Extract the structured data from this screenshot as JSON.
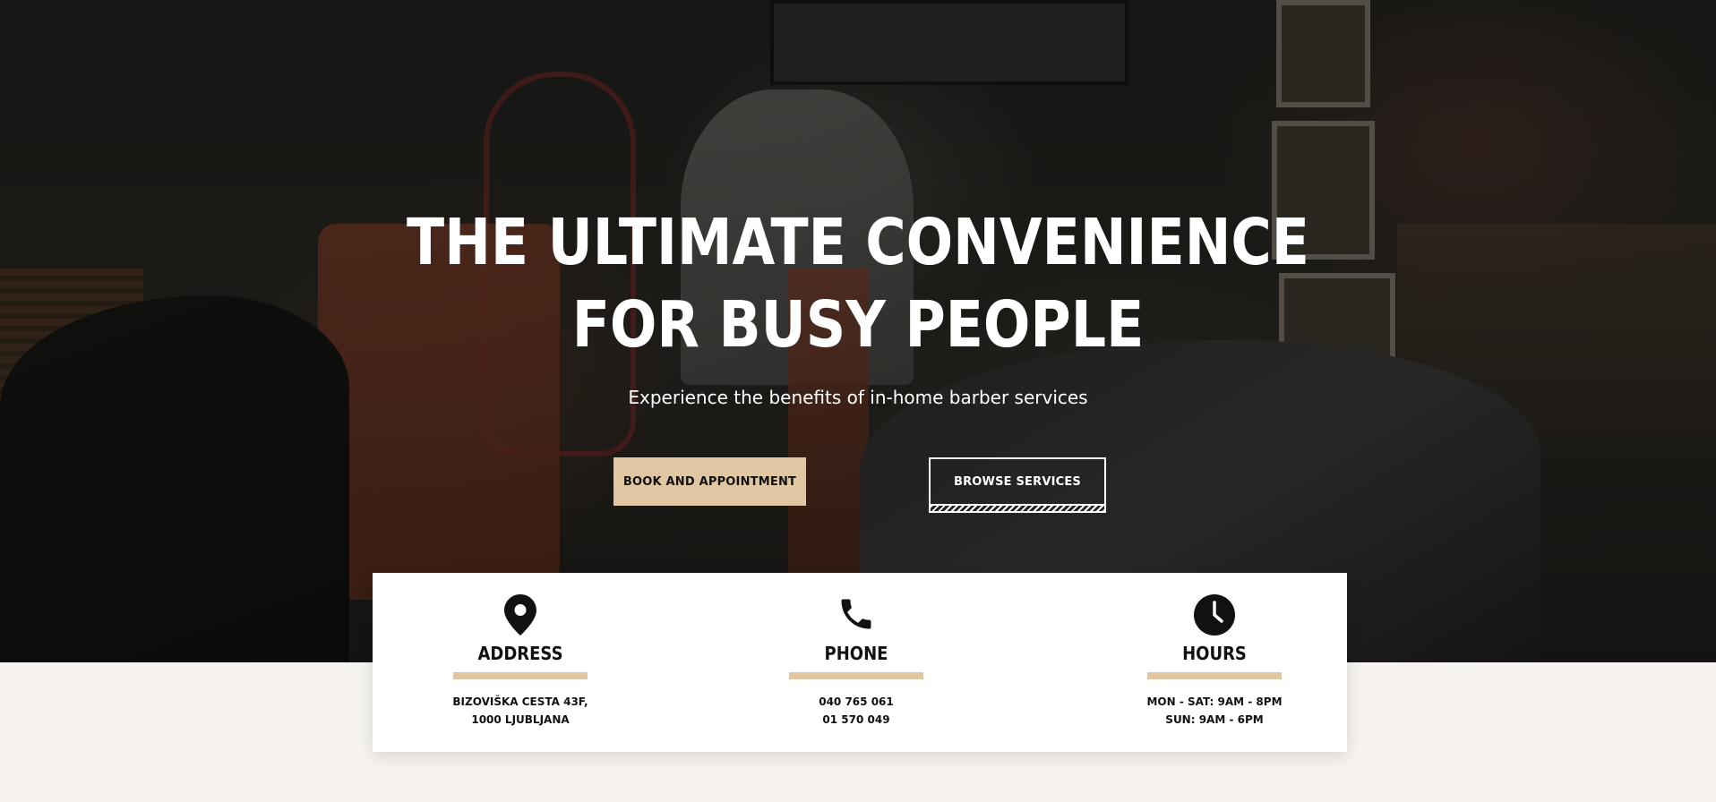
{
  "hero": {
    "title_line1": "THE ULTIMATE CONVENIENCE",
    "title_line2": "FOR BUSY PEOPLE",
    "subtitle": "Experience the benefits of in-home barber services",
    "book_button": "BOOK AND APPOINTMENT",
    "browse_button": "BROWSE SERVICES"
  },
  "info": {
    "address": {
      "icon": "map-pin-icon",
      "title": "ADDRESS",
      "line1": "BIZOVIŠKA CESTA 43F,",
      "line2": "1000 LJUBLJANA"
    },
    "phone": {
      "icon": "phone-icon",
      "title": "PHONE",
      "line1": "040 765 061",
      "line2": "01 570 049"
    },
    "hours": {
      "icon": "clock-icon",
      "title": "HOURS",
      "line1": "MON - SAT: 9AM - 8PM",
      "line2": "SUN: 9AM - 6PM"
    }
  },
  "colors": {
    "accent": "#e1c6a2",
    "page_background": "#f7f4ef",
    "text_dark": "#111111",
    "text_light": "#ffffff"
  }
}
